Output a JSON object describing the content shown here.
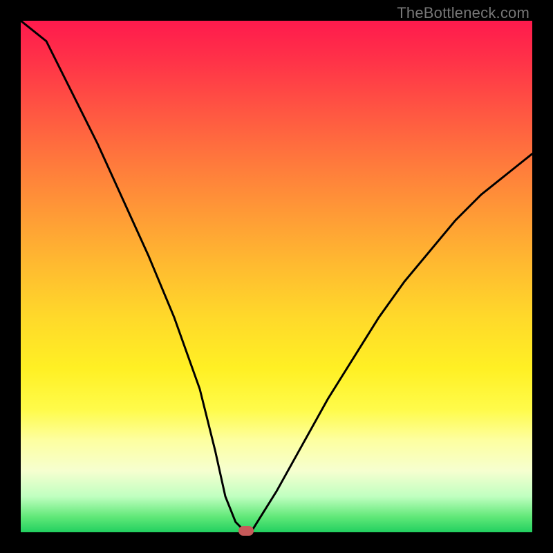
{
  "watermark": "TheBottleneck.com",
  "chart_data": {
    "type": "line",
    "title": "",
    "xlabel": "",
    "ylabel": "",
    "xlim": [
      0,
      100
    ],
    "ylim": [
      0,
      100
    ],
    "grid": false,
    "series": [
      {
        "name": "curve",
        "x": [
          0,
          5,
          10,
          15,
          20,
          25,
          30,
          35,
          38,
          40,
          42,
          44,
          45,
          50,
          55,
          60,
          65,
          70,
          75,
          80,
          85,
          90,
          95,
          100
        ],
        "values": [
          105,
          96,
          86,
          76,
          65,
          54,
          42,
          28,
          16,
          7,
          2,
          0,
          0,
          8,
          17,
          26,
          34,
          42,
          49,
          55,
          61,
          66,
          70,
          74
        ]
      }
    ],
    "marker": {
      "x": 44,
      "y": 0
    }
  },
  "colors": {
    "curve": "#000000",
    "marker": "#c65a5a",
    "background_top": "#ff1a4d",
    "background_bottom": "#22d060"
  }
}
